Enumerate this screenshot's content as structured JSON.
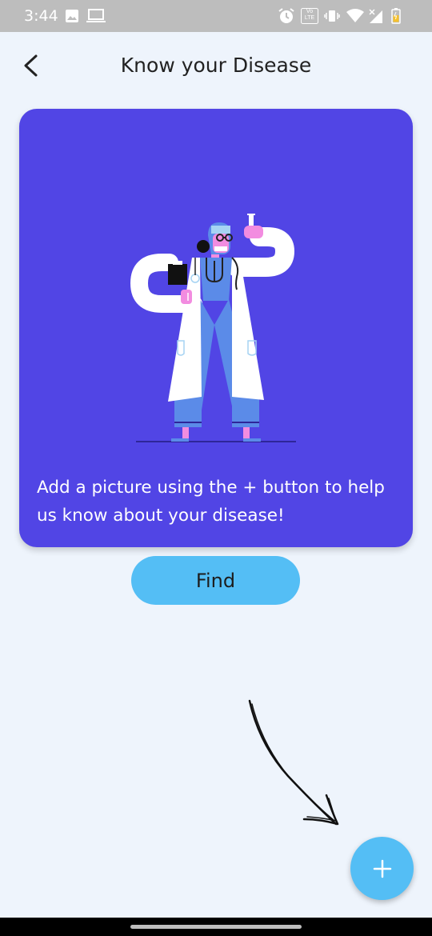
{
  "status_bar": {
    "time": "3:44",
    "icons": [
      "image-icon",
      "laptop-icon",
      "alarm-icon",
      "volte-icon",
      "vibrate-icon",
      "wifi-icon",
      "signal-icon",
      "battery-icon"
    ],
    "volte_text": "Vo LTE"
  },
  "header": {
    "back_icon": "chevron-left-icon",
    "title": "Know your Disease"
  },
  "hero": {
    "illustration": "doctor-illustration",
    "text": "Add a picture using the + button to help us know about your disease!",
    "background": "#5145E5"
  },
  "actions": {
    "find_label": "Find",
    "add_icon": "plus-icon",
    "accent": "#54BEF5"
  }
}
